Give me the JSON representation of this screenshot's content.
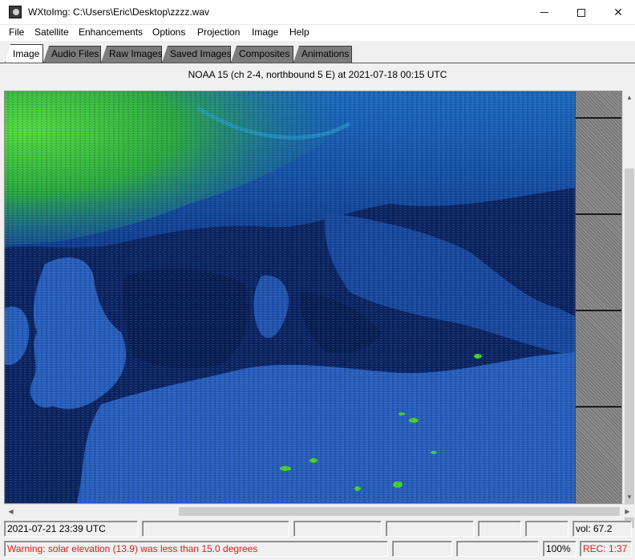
{
  "window": {
    "title": "WXtoImg: C:\\Users\\Eric\\Desktop\\zzzz.wav",
    "minimize_glyph": "—",
    "maximize_glyph": "□",
    "close_glyph": "✕"
  },
  "menu": {
    "items": [
      "File",
      "Satellite",
      "Enhancements",
      "Options",
      "Projection",
      "Image",
      "Help"
    ]
  },
  "tabs": {
    "items": [
      "Image",
      "Audio Files",
      "Raw Images",
      "Saved Images",
      "Composites",
      "Animations"
    ],
    "active": "Image"
  },
  "image": {
    "caption": "NOAA 15 (ch 2-4, northbound  5 E) at 2021-07-18  00:15 UTC",
    "palette": {
      "sea": "#0d2566",
      "land": "#2a63c7",
      "cloud": "#1e9bd6",
      "cold_cloud": "#4de02a"
    }
  },
  "status": {
    "datetime": "2021-07-21  23:39 UTC",
    "volume": "vol: 67.2",
    "warning": "Warning: solar elevation (13.9) was less than 15.0 degrees",
    "zoom": "100%",
    "record": "REC: 1:37",
    "warning_color": "#e01b1b"
  },
  "icons": {
    "app": "wxtoimg-app-icon",
    "scroll_up": "▲",
    "scroll_down": "▼",
    "scroll_left": "◀",
    "scroll_right": "▶"
  }
}
